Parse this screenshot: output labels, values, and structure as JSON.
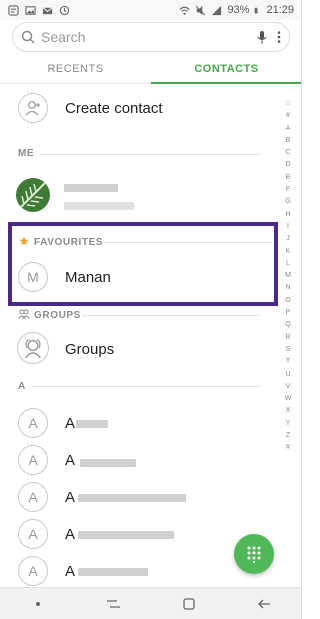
{
  "status": {
    "battery": "93%",
    "time": "21:29",
    "left_icons": [
      "notification-icon",
      "image-icon",
      "mail-icon",
      "sync-icon"
    ],
    "right_icons": [
      "wifi-icon",
      "mute-icon",
      "signal-icon",
      "battery-icon"
    ]
  },
  "search": {
    "placeholder": "Search"
  },
  "tabs": [
    {
      "label": "RECENTS",
      "active": false
    },
    {
      "label": "CONTACTS",
      "active": true
    }
  ],
  "create_contact": {
    "label": "Create contact"
  },
  "sections": {
    "me": "ME",
    "favourites": "FAVOURITES",
    "groups": "GROUPS",
    "a": "A"
  },
  "favourites": [
    {
      "initial": "M",
      "name": "Manan"
    }
  ],
  "groups_row": {
    "label": "Groups"
  },
  "contacts_a": [
    {
      "initial": "A",
      "name_visible": "A"
    },
    {
      "initial": "A",
      "name_visible": "A"
    },
    {
      "initial": "A",
      "name_visible": "A"
    },
    {
      "initial": "A",
      "name_visible": "A"
    },
    {
      "initial": "A",
      "name_visible": "A"
    }
  ],
  "index_letters": [
    "☆",
    "#",
    "A",
    "B",
    "C",
    "D",
    "E",
    "F",
    "G",
    "H",
    "I",
    "J",
    "K",
    "L",
    "M",
    "N",
    "O",
    "P",
    "Q",
    "R",
    "S",
    "T",
    "U",
    "V",
    "W",
    "X",
    "Y",
    "Z",
    "#"
  ],
  "colors": {
    "accent": "#47a84a",
    "fab": "#51b85a",
    "highlight_box": "#4c2a84",
    "star": "#f0a030"
  }
}
